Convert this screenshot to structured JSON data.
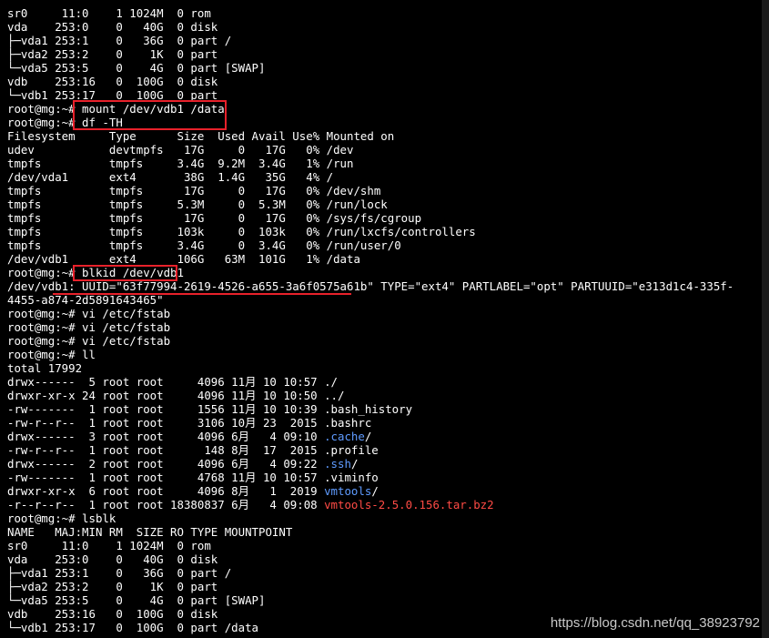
{
  "terminal": {
    "lines": [
      "sr0     11:0    1 1024M  0 rom",
      "vda    253:0    0   40G  0 disk",
      "├─vda1 253:1    0   36G  0 part /",
      "├─vda2 253:2    0    1K  0 part",
      "└─vda5 253:5    0    4G  0 part [SWAP]",
      "vdb    253:16   0  100G  0 disk",
      "└─vdb1 253:17   0  100G  0 part",
      "root@mg:~# mount /dev/vdb1 /data",
      "root@mg:~# df -TH",
      "Filesystem     Type      Size  Used Avail Use% Mounted on",
      "udev           devtmpfs   17G     0   17G   0% /dev",
      "tmpfs          tmpfs     3.4G  9.2M  3.4G   1% /run",
      "/dev/vda1      ext4       38G  1.4G   35G   4% /",
      "tmpfs          tmpfs      17G     0   17G   0% /dev/shm",
      "tmpfs          tmpfs     5.3M     0  5.3M   0% /run/lock",
      "tmpfs          tmpfs      17G     0   17G   0% /sys/fs/cgroup",
      "tmpfs          tmpfs     103k     0  103k   0% /run/lxcfs/controllers",
      "tmpfs          tmpfs     3.4G     0  3.4G   0% /run/user/0",
      "/dev/vdb1      ext4      106G   63M  101G   1% /data",
      "root@mg:~# blkid /dev/vdb1",
      "/dev/vdb1: UUID=\"63f77994-2619-4526-a655-3a6f0575a61b\" TYPE=\"ext4\" PARTLABEL=\"opt\" PARTUUID=\"e313d1c4-335f-",
      "4455-a874-2d5891643465\"",
      "root@mg:~# vi /etc/fstab",
      "root@mg:~# vi /etc/fstab",
      "root@mg:~# vi /etc/fstab",
      "root@mg:~# ll",
      "total 17992",
      "drwx------  5 root root     4096 11月 10 10:57 ./",
      "drwxr-xr-x 24 root root     4096 11月 10 10:50 ../",
      "-rw-------  1 root root     1556 11月 10 10:39 .bash_history",
      "-rw-r--r--  1 root root     3106 10月 23  2015 .bashrc",
      "drwx------  3 root root     4096 6月   4 09:10 ",
      "-rw-r--r--  1 root root      148 8月  17  2015 .profile",
      "drwx------  2 root root     4096 6月   4 09:22 ",
      "-rw-------  1 root root     4768 11月 10 10:57 .viminfo",
      "drwxr-xr-x  6 root root     4096 8月   1  2019 ",
      "-r--r--r--  1 root root 18380837 6月   4 09:08 ",
      "root@mg:~# lsblk",
      "NAME   MAJ:MIN RM  SIZE RO TYPE MOUNTPOINT",
      "sr0     11:0    1 1024M  0 rom",
      "vda    253:0    0   40G  0 disk",
      "├─vda1 253:1    0   36G  0 part /",
      "├─vda2 253:2    0    1K  0 part",
      "└─vda5 253:5    0    4G  0 part [SWAP]",
      "vdb    253:16   0  100G  0 disk",
      "└─vdb1 253:17   0  100G  0 part /data"
    ],
    "colored": {
      "cache_dir": ".cache",
      "ssh_dir": ".ssh",
      "vmtools_dir": "vmtools",
      "tarball": "vmtools-2.5.0.156.tar.bz2",
      "slash": "/"
    },
    "colors": {
      "background": "#000000",
      "text": "#ffffff",
      "directory": "#5f9bff",
      "archive": "#ff4b45",
      "highlight_box": "#e8212b"
    }
  },
  "watermark": "https://blog.csdn.net/qq_38923792"
}
